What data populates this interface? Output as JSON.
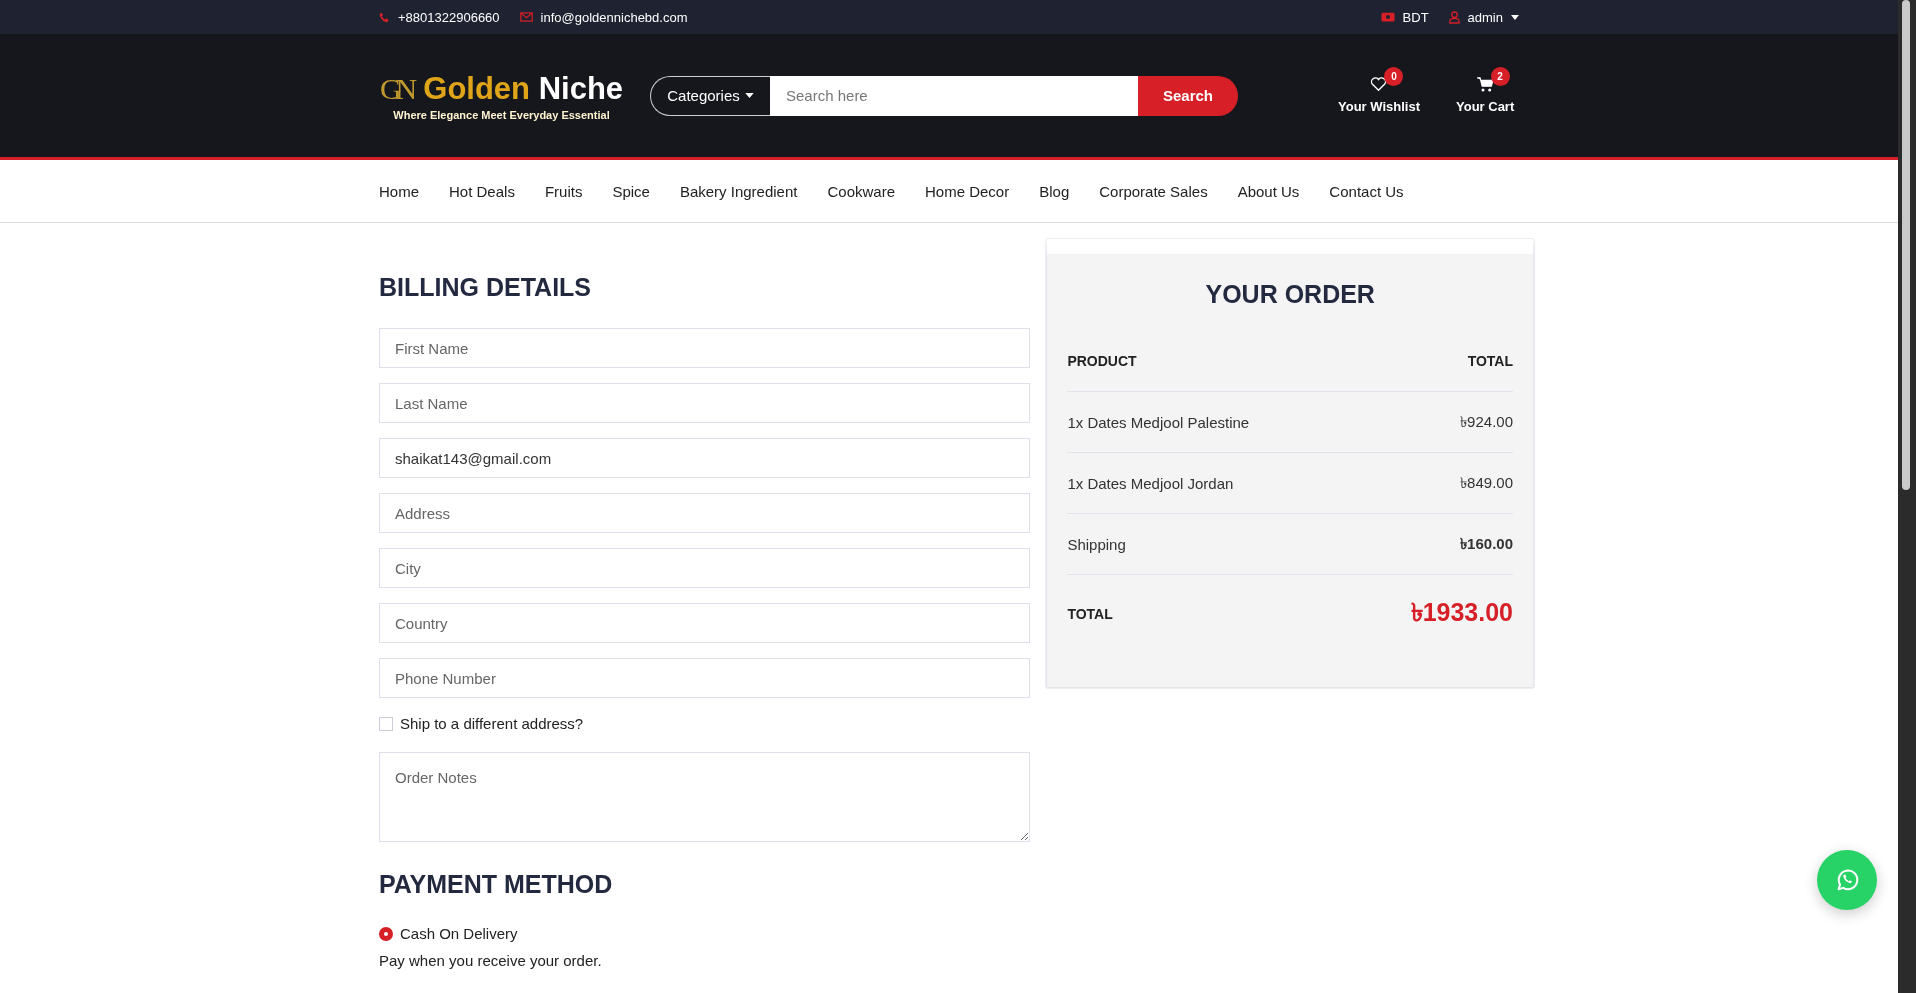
{
  "topbar": {
    "phone": "+8801322906660",
    "email": "info@goldennichebd.com",
    "currency": "BDT",
    "user": "admin"
  },
  "header": {
    "logo": {
      "mark": "GN",
      "name_first": "Golden",
      "name_second": "Niche",
      "tagline": "Where Elegance Meet Everyday Essential"
    },
    "search": {
      "category": "Categories",
      "placeholder": "Search here",
      "button": "Search"
    },
    "actions": [
      {
        "kind": "wishlist",
        "label": "Your Wishlist",
        "badge": "0"
      },
      {
        "kind": "cart",
        "label": "Your Cart",
        "badge": "2"
      }
    ]
  },
  "nav": [
    "Home",
    "Hot Deals",
    "Fruits",
    "Spice",
    "Bakery Ingredient",
    "Cookware",
    "Home Decor",
    "Blog",
    "Corporate Sales",
    "About Us",
    "Contact Us"
  ],
  "billing": {
    "title": "BILLING DETAILS",
    "fields": [
      {
        "placeholder": "First Name"
      },
      {
        "placeholder": "Last Name"
      },
      {
        "value": "shaikat143@gmail.com"
      },
      {
        "placeholder": "Address"
      },
      {
        "placeholder": "City"
      },
      {
        "placeholder": "Country"
      },
      {
        "placeholder": "Phone Number"
      }
    ],
    "ship_different": {
      "label": "Ship to a different address?",
      "checked": false
    },
    "notes": {
      "placeholder": "Order Notes"
    }
  },
  "payment": {
    "title": "PAYMENT METHOD",
    "options": [
      {
        "label": "Cash On Delivery",
        "selected": true
      }
    ],
    "description": "Pay when you receive your order."
  },
  "order": {
    "title": "YOUR ORDER",
    "columns": [
      "PRODUCT",
      "TOTAL"
    ],
    "lines": [
      {
        "kind": "item",
        "label": "1x Dates Medjool Palestine",
        "amount": "৳924.00"
      },
      {
        "kind": "item",
        "label": "1x Dates Medjool Jordan",
        "amount": "৳849.00"
      },
      {
        "kind": "shipping",
        "label": "Shipping",
        "amount": "৳160.00"
      }
    ],
    "total": {
      "label": "TOTAL",
      "amount": "৳1933.00"
    }
  }
}
